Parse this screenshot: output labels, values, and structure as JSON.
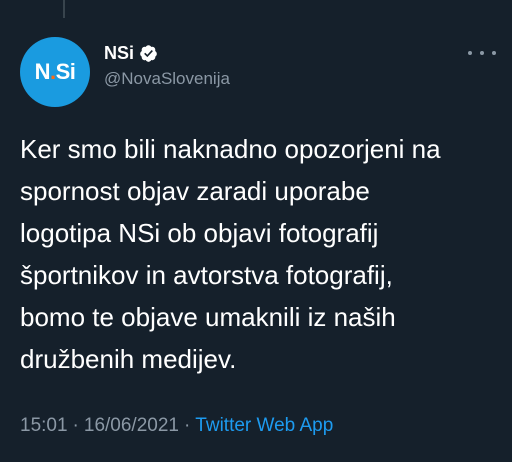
{
  "author": {
    "avatar_text": "N",
    "avatar_dot": ".",
    "avatar_text2": "Si",
    "display_name": "NSi",
    "handle": "@NovaSlovenija",
    "verified_icon": "verified-badge-icon"
  },
  "tweet": {
    "text": "Ker smo bili naknadno opozorjeni na\nspornost objav zaradi uporabe\nlogotipa NSi ob objavi fotografij\nšportnikov in avtorstva fotografij,\nbomo te objave umaknili iz naših\ndružbenih medijev."
  },
  "meta": {
    "time": "15:01",
    "separator": "·",
    "date": "16/06/2021",
    "source": "Twitter Web App"
  },
  "colors": {
    "background": "#15202b",
    "avatar": "#1a9be0",
    "avatar_dot": "#ff6a13",
    "secondary_text": "#8b98a5",
    "link": "#1d9bf0"
  }
}
